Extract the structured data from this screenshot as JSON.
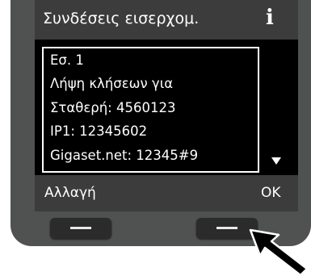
{
  "screen": {
    "title": "Συνδέσεις εισερχομ.",
    "info_icon": "i",
    "lines": [
      "Εσ. 1",
      "Λήψη κλήσεων για",
      "Σταθερή: 4560123",
      "IP1: 12345602",
      "Gigaset.net: 12345#9"
    ],
    "scroll_indicator": "scroll-down-arrow-icon"
  },
  "softkeys": {
    "left_label": "Αλλαγή",
    "right_label": "OK"
  },
  "colors": {
    "device_body": "#505252",
    "display_background": "#000000",
    "bar_background": "#3c3c3c",
    "text": "#ffffff",
    "key": "#2b2b2b"
  },
  "icons": {
    "info": "info-icon",
    "pointer": "pointer-arrow-icon"
  }
}
